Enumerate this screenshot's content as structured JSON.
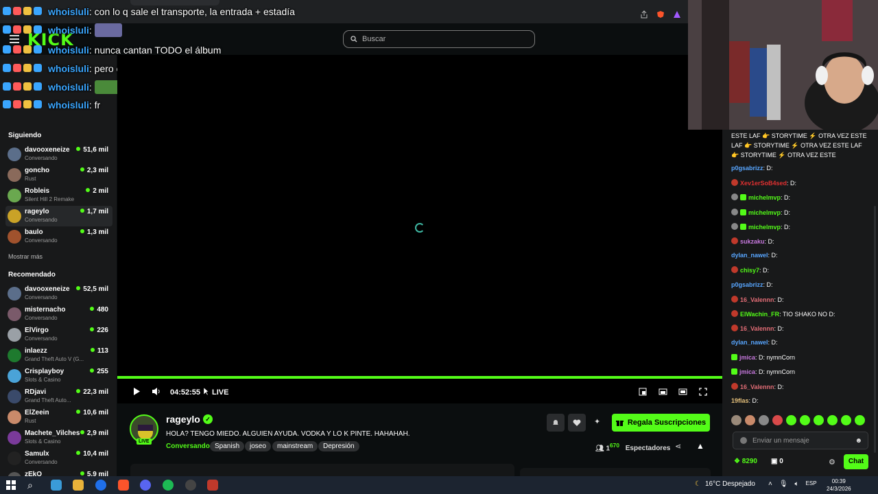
{
  "browser": {
    "url_hint": "kick.com/rageylo"
  },
  "header": {
    "logo": "KICK",
    "search_placeholder": "Buscar"
  },
  "overlay_chat": [
    {
      "user": "whoisluli",
      "text": "con lo q sale el transporte, la entrada + estadía",
      "emote": false
    },
    {
      "user": "whoisluli",
      "text": "",
      "emote": true
    },
    {
      "user": "whoisluli",
      "text": "nunca cantan TODO el álbum",
      "emote": false
    },
    {
      "user": "whoisluli",
      "text": "pero cantará bastantes",
      "emote": false
    },
    {
      "user": "whoisluli",
      "text": "",
      "emote": true
    },
    {
      "user": "whoisluli",
      "text": "fr",
      "emote": false
    }
  ],
  "sidebar": {
    "following_title": "Siguiendo",
    "following": [
      {
        "name": "davooxeneize",
        "category": "Conversando",
        "viewers": "51,6 mil",
        "color": "#5b6e8a"
      },
      {
        "name": "goncho",
        "category": "Rust",
        "viewers": "2,3 mil",
        "color": "#8a6a5b"
      },
      {
        "name": "Robleis",
        "category": "Silent Hill 2 Remake",
        "viewers": "2 mil",
        "color": "#6aa84f"
      },
      {
        "name": "rageylo",
        "category": "Conversando",
        "viewers": "1,7 mil",
        "color": "#c9a227"
      },
      {
        "name": "baulo",
        "category": "Conversando",
        "viewers": "1,3 mil",
        "color": "#a0522d"
      }
    ],
    "show_more": "Mostrar más",
    "recommended_title": "Recomendado",
    "recommended": [
      {
        "name": "davooxeneize",
        "category": "Conversando",
        "viewers": "52,5 mil",
        "color": "#5b6e8a"
      },
      {
        "name": "misternacho",
        "category": "Conversando",
        "viewers": "480",
        "color": "#7a5a6a"
      },
      {
        "name": "ElVirgo",
        "category": "Conversando",
        "viewers": "226",
        "color": "#9aa0a6"
      },
      {
        "name": "inlaezz",
        "category": "Grand Theft Auto V (G...",
        "viewers": "113",
        "color": "#1e7a2e"
      },
      {
        "name": "Crisplayboy",
        "category": "Slots & Casino",
        "viewers": "255",
        "color": "#4aa3d8"
      },
      {
        "name": "RDjavi",
        "category": "Grand Theft Auto...",
        "viewers": "22,3 mil",
        "color": "#3a4a6a"
      },
      {
        "name": "ElZeein",
        "category": "Rust",
        "viewers": "10,6 mil",
        "color": "#c98a6a"
      },
      {
        "name": "Machete_Vilches",
        "category": "Slots & Casino",
        "viewers": "2,9 mil",
        "color": "#7a3a9a"
      },
      {
        "name": "Samulx",
        "category": "Conversando",
        "viewers": "10,4 mil",
        "color": "#222222"
      },
      {
        "name": "zEkO",
        "category": "",
        "viewers": "5,9 mil",
        "color": "#555555"
      }
    ]
  },
  "player": {
    "time": "04:52:55",
    "live_label": "LIVE",
    "progress": 1.0
  },
  "stream": {
    "name": "rageylo",
    "live_badge": "LIVE",
    "title": "HOLA? TENGO MIEDO. ALGUIEN AYUDA. VODKA Y LO K PINTE. HAHAHAH.",
    "category": "Conversando",
    "tags": [
      "Spanish",
      "joseo",
      "mainstream",
      "Depresión"
    ],
    "subs_button": "Regala Suscripciones",
    "viewers_prefix": "1",
    "viewers_sup": "67",
    "viewers_suffix": "0",
    "viewers_label": "Espectadores"
  },
  "chat": {
    "pinned": "ESTE LAF 👉 STORYTIME ⚡ OTRA VEZ ESTE LAF 👉 STORYTIME ⚡ OTRA VEZ ESTE LAF 👉 STORYTIME ⚡ OTRA VEZ ESTE",
    "messages": [
      {
        "user": "p0gsabrizz",
        "text": ": D:",
        "color": "#58a6ff",
        "badge": "none"
      },
      {
        "user": "Xev1erSoB4sed",
        "text": ": D:",
        "color": "#e03030",
        "badge": "circle"
      },
      {
        "user": "michelmvp",
        "text": ": D:",
        "color": "#53fc18",
        "badge": "both"
      },
      {
        "user": "michelmvp",
        "text": ": D:",
        "color": "#53fc18",
        "badge": "both"
      },
      {
        "user": "michelmvp",
        "text": ": D:",
        "color": "#53fc18",
        "badge": "both"
      },
      {
        "user": "sukzaku",
        "text": ": D:",
        "color": "#c678dd",
        "badge": "circle"
      },
      {
        "user": "dylan_nawel",
        "text": ": D:",
        "color": "#58a6ff",
        "badge": "none"
      },
      {
        "user": "chisy7",
        "text": ": D:",
        "color": "#53fc18",
        "badge": "circle"
      },
      {
        "user": "p0gsabrizz",
        "text": ": D:",
        "color": "#58a6ff",
        "badge": "none"
      },
      {
        "user": "16_Valennn",
        "text": ": D:",
        "color": "#e06c75",
        "badge": "circle"
      },
      {
        "user": "ElWachin_FR",
        "text": ": TIO SHAKO NO D:",
        "color": "#53fc18",
        "badge": "circle"
      },
      {
        "user": "16_Valennn",
        "text": ": D:",
        "color": "#e06c75",
        "badge": "circle"
      },
      {
        "user": "dylan_nawel",
        "text": ": D:",
        "color": "#58a6ff",
        "badge": "none"
      },
      {
        "user": "jmica",
        "text": ": D: nymnCorn",
        "color": "#c678dd",
        "badge": "square"
      },
      {
        "user": "jmica",
        "text": ": D: nymnCorn",
        "color": "#c678dd",
        "badge": "square"
      },
      {
        "user": "16_Valennn",
        "text": ": D:",
        "color": "#e06c75",
        "badge": "circle"
      },
      {
        "user": "19flas",
        "text": ": D:",
        "color": "#e5c07b",
        "badge": "none"
      }
    ],
    "input_placeholder": "Enviar un mensaje",
    "points": "8290",
    "drops": "0",
    "chat_button": "Chat"
  },
  "taskbar": {
    "weather": "16°C  Despejado",
    "lang": "ESP",
    "time": "00:39",
    "date": "24/3/2026"
  },
  "colors": {
    "accent": "#53fc18",
    "sidebar_bg": "#18191a",
    "page_bg": "#0b0e0f"
  }
}
